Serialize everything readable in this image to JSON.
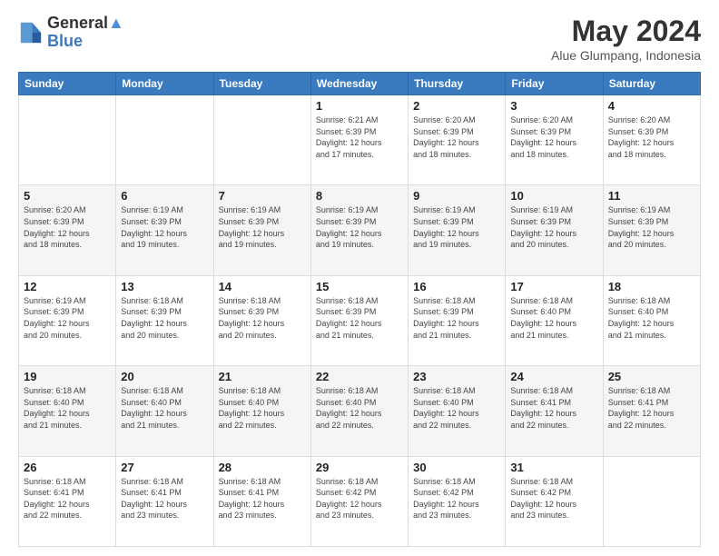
{
  "header": {
    "logo_line1": "General",
    "logo_line2": "Blue",
    "month_year": "May 2024",
    "location": "Alue Glumpang, Indonesia"
  },
  "columns": [
    "Sunday",
    "Monday",
    "Tuesday",
    "Wednesday",
    "Thursday",
    "Friday",
    "Saturday"
  ],
  "weeks": [
    [
      {
        "day": "",
        "info": ""
      },
      {
        "day": "",
        "info": ""
      },
      {
        "day": "",
        "info": ""
      },
      {
        "day": "1",
        "info": "Sunrise: 6:21 AM\nSunset: 6:39 PM\nDaylight: 12 hours\nand 17 minutes."
      },
      {
        "day": "2",
        "info": "Sunrise: 6:20 AM\nSunset: 6:39 PM\nDaylight: 12 hours\nand 18 minutes."
      },
      {
        "day": "3",
        "info": "Sunrise: 6:20 AM\nSunset: 6:39 PM\nDaylight: 12 hours\nand 18 minutes."
      },
      {
        "day": "4",
        "info": "Sunrise: 6:20 AM\nSunset: 6:39 PM\nDaylight: 12 hours\nand 18 minutes."
      }
    ],
    [
      {
        "day": "5",
        "info": "Sunrise: 6:20 AM\nSunset: 6:39 PM\nDaylight: 12 hours\nand 18 minutes."
      },
      {
        "day": "6",
        "info": "Sunrise: 6:19 AM\nSunset: 6:39 PM\nDaylight: 12 hours\nand 19 minutes."
      },
      {
        "day": "7",
        "info": "Sunrise: 6:19 AM\nSunset: 6:39 PM\nDaylight: 12 hours\nand 19 minutes."
      },
      {
        "day": "8",
        "info": "Sunrise: 6:19 AM\nSunset: 6:39 PM\nDaylight: 12 hours\nand 19 minutes."
      },
      {
        "day": "9",
        "info": "Sunrise: 6:19 AM\nSunset: 6:39 PM\nDaylight: 12 hours\nand 19 minutes."
      },
      {
        "day": "10",
        "info": "Sunrise: 6:19 AM\nSunset: 6:39 PM\nDaylight: 12 hours\nand 20 minutes."
      },
      {
        "day": "11",
        "info": "Sunrise: 6:19 AM\nSunset: 6:39 PM\nDaylight: 12 hours\nand 20 minutes."
      }
    ],
    [
      {
        "day": "12",
        "info": "Sunrise: 6:19 AM\nSunset: 6:39 PM\nDaylight: 12 hours\nand 20 minutes."
      },
      {
        "day": "13",
        "info": "Sunrise: 6:18 AM\nSunset: 6:39 PM\nDaylight: 12 hours\nand 20 minutes."
      },
      {
        "day": "14",
        "info": "Sunrise: 6:18 AM\nSunset: 6:39 PM\nDaylight: 12 hours\nand 20 minutes."
      },
      {
        "day": "15",
        "info": "Sunrise: 6:18 AM\nSunset: 6:39 PM\nDaylight: 12 hours\nand 21 minutes."
      },
      {
        "day": "16",
        "info": "Sunrise: 6:18 AM\nSunset: 6:39 PM\nDaylight: 12 hours\nand 21 minutes."
      },
      {
        "day": "17",
        "info": "Sunrise: 6:18 AM\nSunset: 6:40 PM\nDaylight: 12 hours\nand 21 minutes."
      },
      {
        "day": "18",
        "info": "Sunrise: 6:18 AM\nSunset: 6:40 PM\nDaylight: 12 hours\nand 21 minutes."
      }
    ],
    [
      {
        "day": "19",
        "info": "Sunrise: 6:18 AM\nSunset: 6:40 PM\nDaylight: 12 hours\nand 21 minutes."
      },
      {
        "day": "20",
        "info": "Sunrise: 6:18 AM\nSunset: 6:40 PM\nDaylight: 12 hours\nand 21 minutes."
      },
      {
        "day": "21",
        "info": "Sunrise: 6:18 AM\nSunset: 6:40 PM\nDaylight: 12 hours\nand 22 minutes."
      },
      {
        "day": "22",
        "info": "Sunrise: 6:18 AM\nSunset: 6:40 PM\nDaylight: 12 hours\nand 22 minutes."
      },
      {
        "day": "23",
        "info": "Sunrise: 6:18 AM\nSunset: 6:40 PM\nDaylight: 12 hours\nand 22 minutes."
      },
      {
        "day": "24",
        "info": "Sunrise: 6:18 AM\nSunset: 6:41 PM\nDaylight: 12 hours\nand 22 minutes."
      },
      {
        "day": "25",
        "info": "Sunrise: 6:18 AM\nSunset: 6:41 PM\nDaylight: 12 hours\nand 22 minutes."
      }
    ],
    [
      {
        "day": "26",
        "info": "Sunrise: 6:18 AM\nSunset: 6:41 PM\nDaylight: 12 hours\nand 22 minutes."
      },
      {
        "day": "27",
        "info": "Sunrise: 6:18 AM\nSunset: 6:41 PM\nDaylight: 12 hours\nand 23 minutes."
      },
      {
        "day": "28",
        "info": "Sunrise: 6:18 AM\nSunset: 6:41 PM\nDaylight: 12 hours\nand 23 minutes."
      },
      {
        "day": "29",
        "info": "Sunrise: 6:18 AM\nSunset: 6:42 PM\nDaylight: 12 hours\nand 23 minutes."
      },
      {
        "day": "30",
        "info": "Sunrise: 6:18 AM\nSunset: 6:42 PM\nDaylight: 12 hours\nand 23 minutes."
      },
      {
        "day": "31",
        "info": "Sunrise: 6:18 AM\nSunset: 6:42 PM\nDaylight: 12 hours\nand 23 minutes."
      },
      {
        "day": "",
        "info": ""
      }
    ]
  ]
}
